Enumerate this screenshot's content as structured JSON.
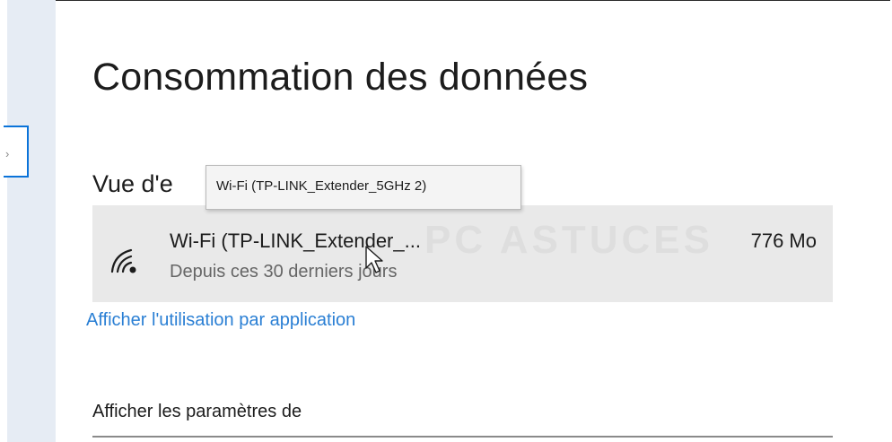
{
  "page": {
    "title": "Consommation des données"
  },
  "overview": {
    "heading": "Vue d'e",
    "tooltip": "Wi-Fi (TP-LINK_Extender_5GHz 2)"
  },
  "network_row": {
    "icon": "wifi-icon",
    "name": "Wi-Fi (TP-LINK_Extender_...",
    "period": "Depuis ces 30 derniers jours",
    "usage": "776 Mo"
  },
  "links": {
    "per_app": "Afficher l'utilisation par application"
  },
  "settings": {
    "label": "Afficher les paramètres de"
  },
  "colors": {
    "accent": "#0a73d9",
    "link": "#2a7fd4",
    "row_background": "#e9e9e9",
    "secondary_text": "#666666"
  }
}
